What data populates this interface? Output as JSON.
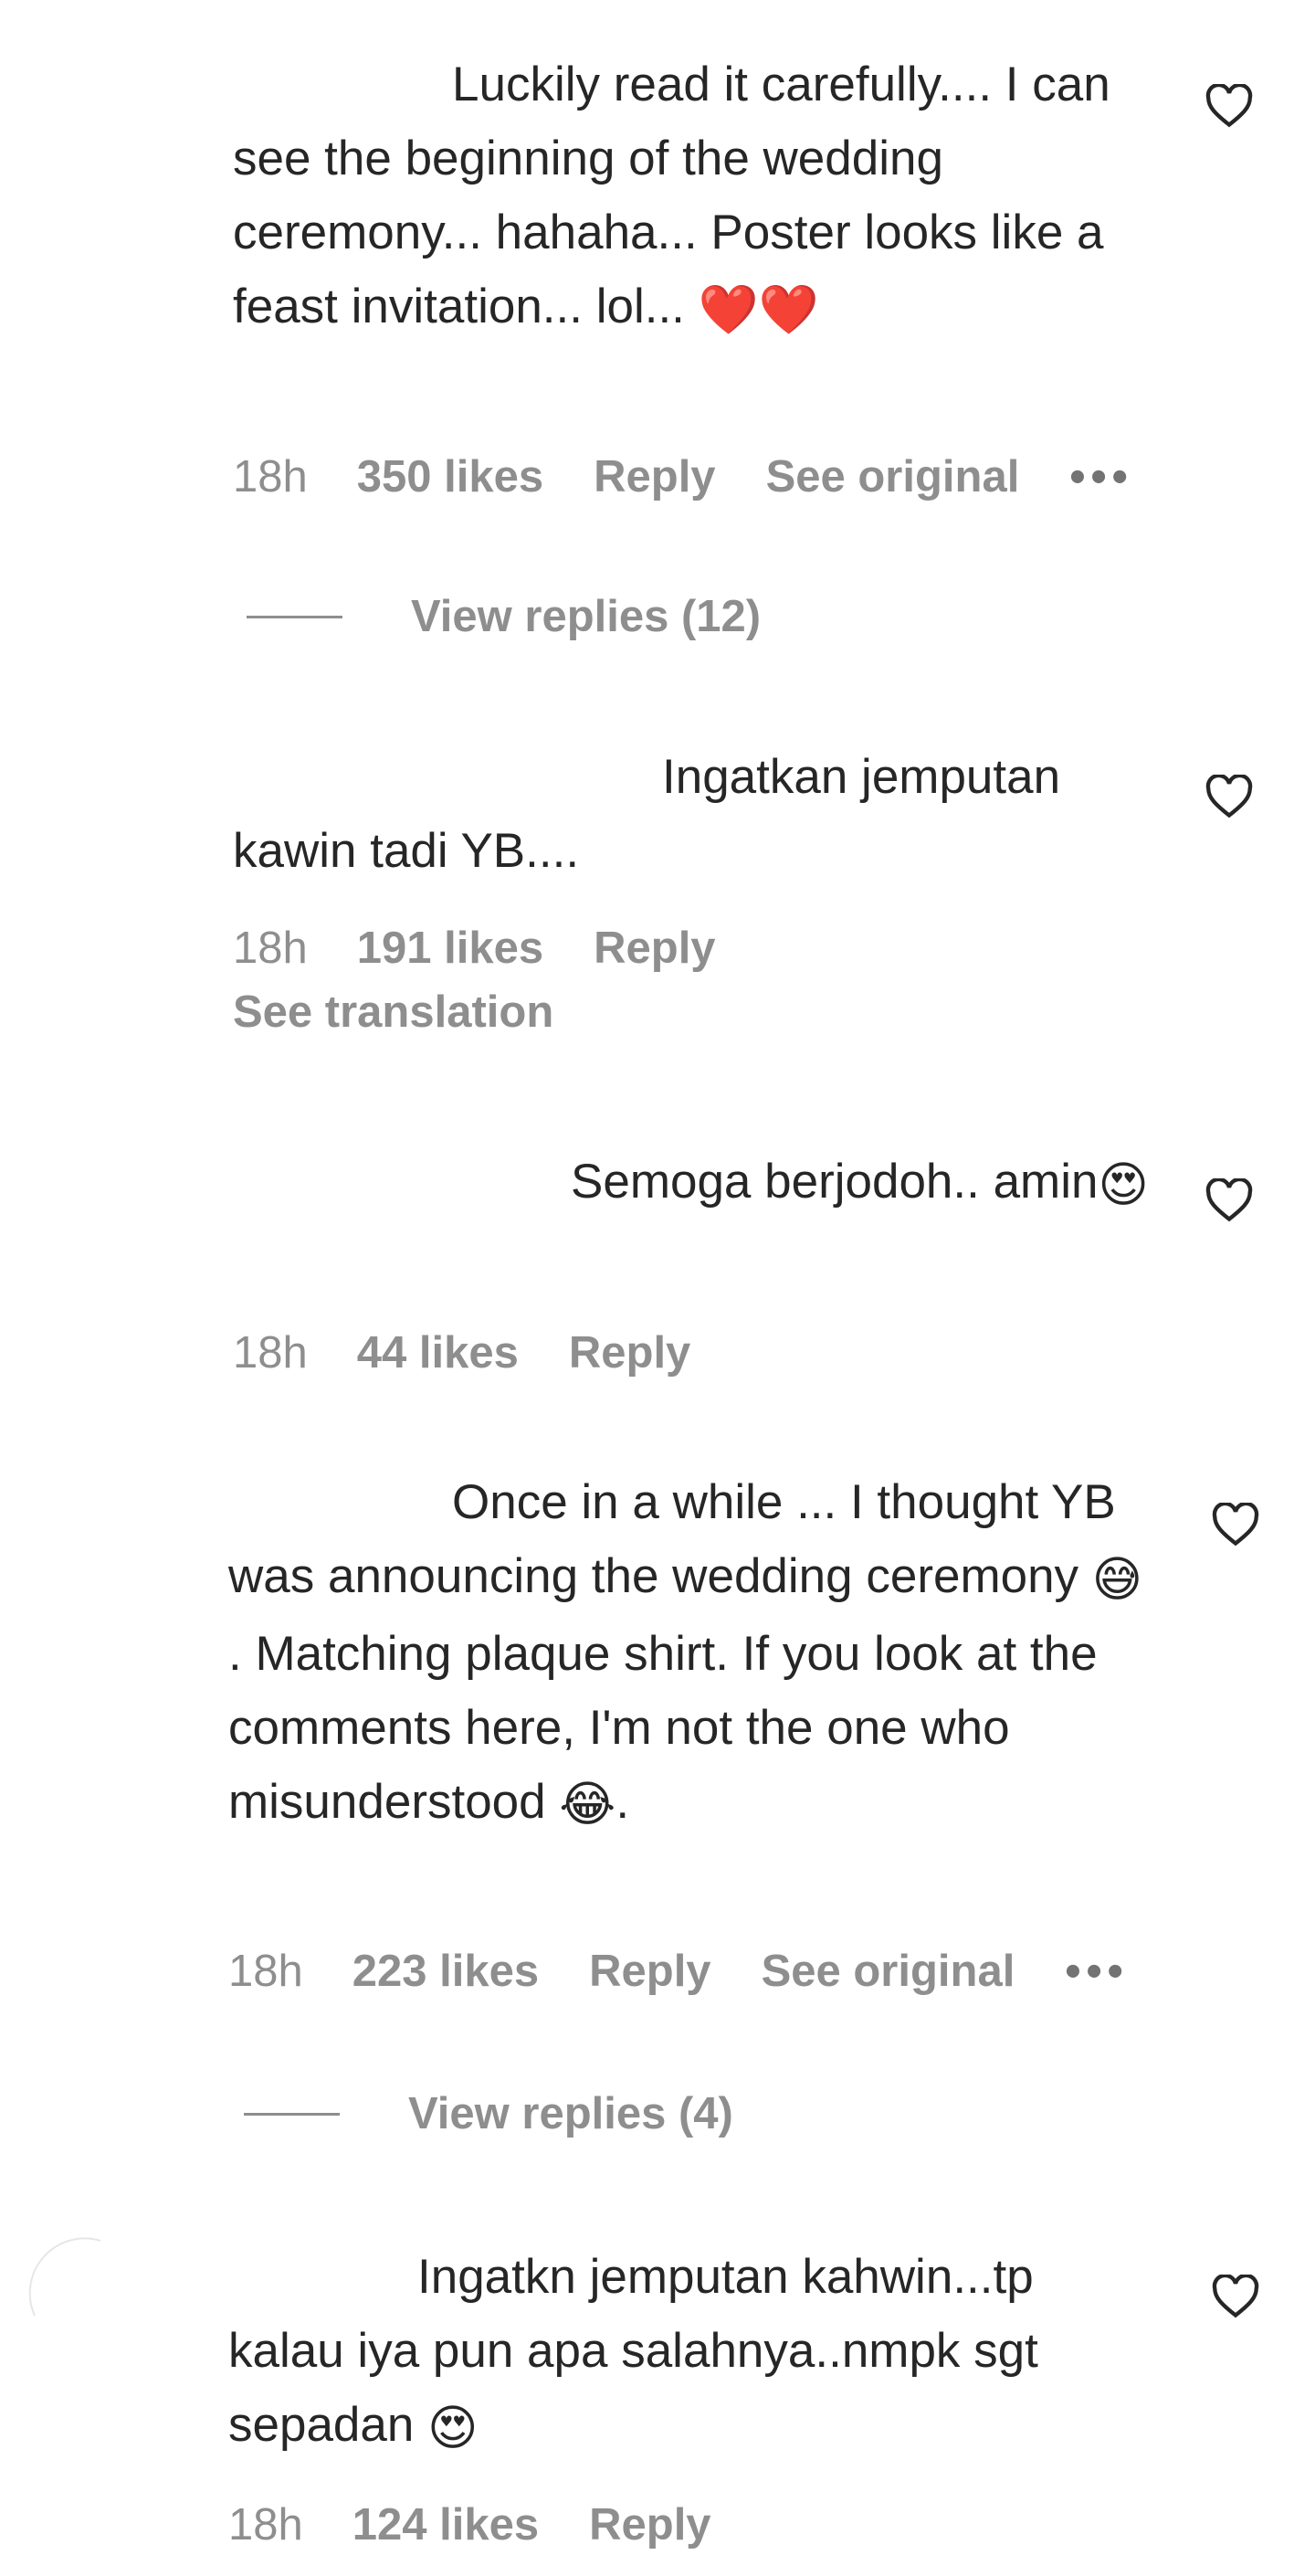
{
  "comments": [
    {
      "text": "Luckily read it carefully.... I can see the beginning of the wedding ceremony... hahaha... Poster looks like a feast invitation... lol...",
      "emoji": "❤️❤️",
      "time": "18h",
      "likes": "350 likes",
      "reply": "Reply",
      "see_original": "See original",
      "more": "•••",
      "view_replies": "View replies (12)"
    },
    {
      "text": "Ingatkan jemputan kawin tadi YB....",
      "time": "18h",
      "likes": "191 likes",
      "reply": "Reply",
      "see_translation": "See translation"
    },
    {
      "text": "Semoga berjodoh.. amin",
      "emoji": "😍",
      "time": "18h",
      "likes": "44 likes",
      "reply": "Reply"
    },
    {
      "text_a": "Once in a while ... I thought YB was announcing the wedding ceremony",
      "emoji_a": "😅",
      "text_b": ". Matching plaque shirt. If you look at the comments here, I'm not the one who misunderstood",
      "emoji_b": "😂",
      "text_c": ".",
      "time": "18h",
      "likes": "223 likes",
      "reply": "Reply",
      "see_original": "See original",
      "more": "•••",
      "view_replies": "View replies (4)"
    },
    {
      "text": "Ingatkn jemputan kahwin...tp kalau iya pun apa salahnya..nmpk sgt sepadan",
      "emoji": "😍",
      "time": "18h",
      "likes": "124 likes",
      "reply": "Reply"
    }
  ],
  "icons": {
    "like": "heart-outline-icon",
    "more": "more-options-icon"
  },
  "colors": {
    "text": "#262626",
    "meta": "#8e8e8e",
    "background": "#ffffff"
  }
}
